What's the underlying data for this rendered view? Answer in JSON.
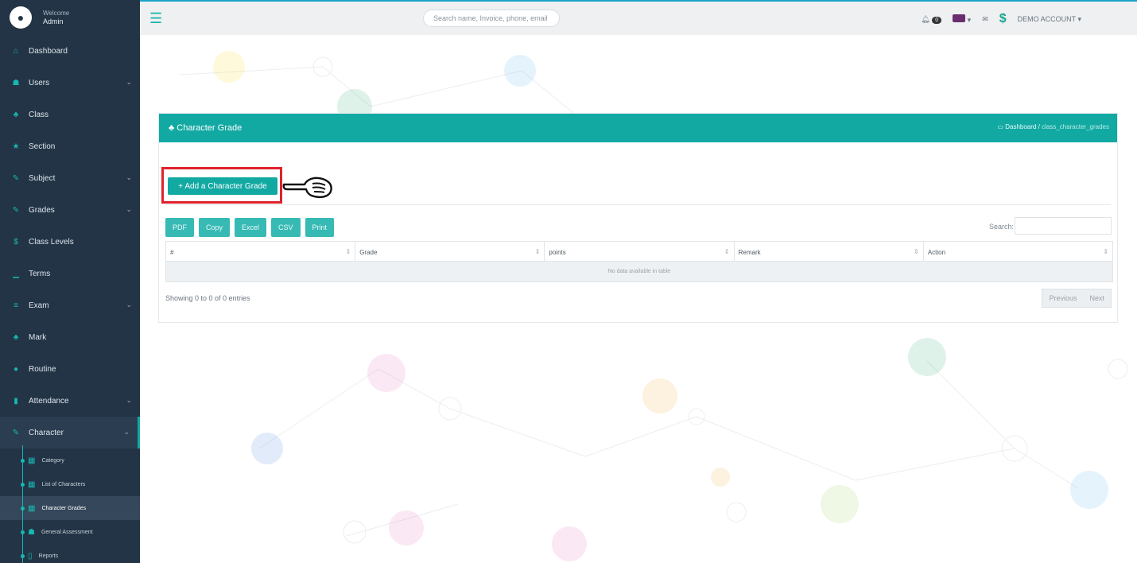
{
  "sidebar": {
    "profile": {
      "welcome": "Welcome",
      "name": "Admin"
    },
    "items": [
      {
        "label": "Dashboard",
        "icon": "home-icon",
        "glyph": "⌂",
        "has_children": false
      },
      {
        "label": "Users",
        "icon": "users-icon",
        "glyph": "☗",
        "has_children": true
      },
      {
        "label": "Class",
        "icon": "sitemap-icon",
        "glyph": "♣",
        "has_children": false
      },
      {
        "label": "Section",
        "icon": "star-icon",
        "glyph": "★",
        "has_children": false
      },
      {
        "label": "Subject",
        "icon": "edit-icon",
        "glyph": "✎",
        "has_children": true
      },
      {
        "label": "Grades",
        "icon": "edit-icon",
        "glyph": "✎",
        "has_children": true
      },
      {
        "label": "Class Levels",
        "icon": "dollar-icon",
        "glyph": "$",
        "has_children": false
      },
      {
        "label": "Terms",
        "icon": "bar-chart-icon",
        "glyph": "▁",
        "has_children": false
      },
      {
        "label": "Exam",
        "icon": "list-icon",
        "glyph": "≡",
        "has_children": true
      },
      {
        "label": "Mark",
        "icon": "sitemap-icon",
        "glyph": "♣",
        "has_children": false
      },
      {
        "label": "Routine",
        "icon": "circle-icon",
        "glyph": "●",
        "has_children": false
      },
      {
        "label": "Attendance",
        "icon": "file-icon",
        "glyph": "▮",
        "has_children": true
      },
      {
        "label": "Character",
        "icon": "edit-icon",
        "glyph": "✎",
        "has_children": true
      }
    ],
    "sub_items": [
      {
        "label": "Category",
        "icon": "table-icon",
        "glyph": "▦"
      },
      {
        "label": "List of Characters",
        "icon": "table-icon",
        "glyph": "▦"
      },
      {
        "label": "Character Grades",
        "icon": "table-icon",
        "glyph": "▦"
      },
      {
        "label": "General Assessment",
        "icon": "users-icon",
        "glyph": "☗"
      },
      {
        "label": "Reports",
        "icon": "file-icon",
        "glyph": "▯"
      }
    ]
  },
  "topbar": {
    "search_placeholder": "Search name, Invoice, phone, email",
    "account_label": "DEMO ACCOUNT ▾",
    "notification_count": "0"
  },
  "panel": {
    "title": "Character Grade",
    "breadcrumb_home": "Dashboard",
    "breadcrumb_sep": "/",
    "breadcrumb_current": "class_character_grades",
    "add_button": "+ Add a Character Grade"
  },
  "table": {
    "export_buttons": [
      "PDF",
      "Copy",
      "Excel",
      "CSV",
      "Print"
    ],
    "search_label": "Search:",
    "columns": [
      "#",
      "Grade",
      "points",
      "Remark",
      "Action"
    ],
    "empty_message": "No data available in table",
    "info": "Showing 0 to 0 of 0 entries",
    "prev_label": "Previous",
    "next_label": "Next"
  },
  "colors": {
    "sidebar_bg": "#233446",
    "accent": "#12a9a3",
    "highlight": "#e0222b"
  }
}
